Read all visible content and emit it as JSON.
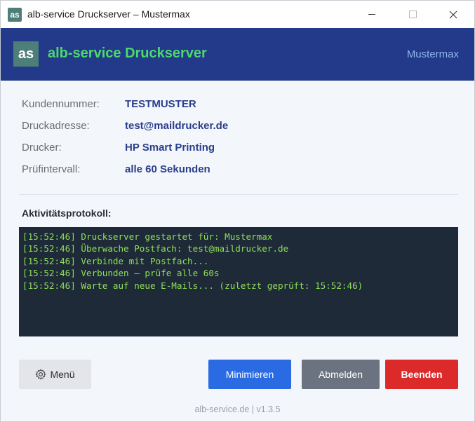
{
  "window": {
    "icon_text": "as",
    "title": "alb-service Druckserver – Mustermax"
  },
  "header": {
    "logo_text": "as",
    "title": "alb-service Druckserver",
    "user": "Mustermax",
    "colors": {
      "background": "#223a89",
      "title": "#4cd96b",
      "user": "#8fb6ec"
    }
  },
  "info": [
    {
      "label": "Kundennummer:",
      "value": "TESTMUSTER"
    },
    {
      "label": "Druckadresse:",
      "value": "test@maildrucker.de"
    },
    {
      "label": "Drucker:",
      "value": "HP Smart Printing"
    },
    {
      "label": "Prüfintervall:",
      "value": "alle 60 Sekunden"
    }
  ],
  "log": {
    "label": "Aktivitätsprotokoll:",
    "lines": [
      "[15:52:46] Druckserver gestartet für: Mustermax",
      "[15:52:46] Überwache Postfach: test@maildrucker.de",
      "[15:52:46] Verbinde mit Postfach...",
      "[15:52:46] Verbunden – prüfe alle 60s",
      "[15:52:46] Warte auf neue E-Mails... (zuletzt geprüft: 15:52:46)"
    ]
  },
  "buttons": {
    "menu": "Menü",
    "menu_icon": "gear-icon",
    "minimize": "Minimieren",
    "logout": "Abmelden",
    "quit": "Beenden",
    "colors": {
      "minimize": "#2a6be3",
      "logout": "#6b7280",
      "quit": "#dc2a2a"
    }
  },
  "footer": "alb-service.de | v1.3.5"
}
